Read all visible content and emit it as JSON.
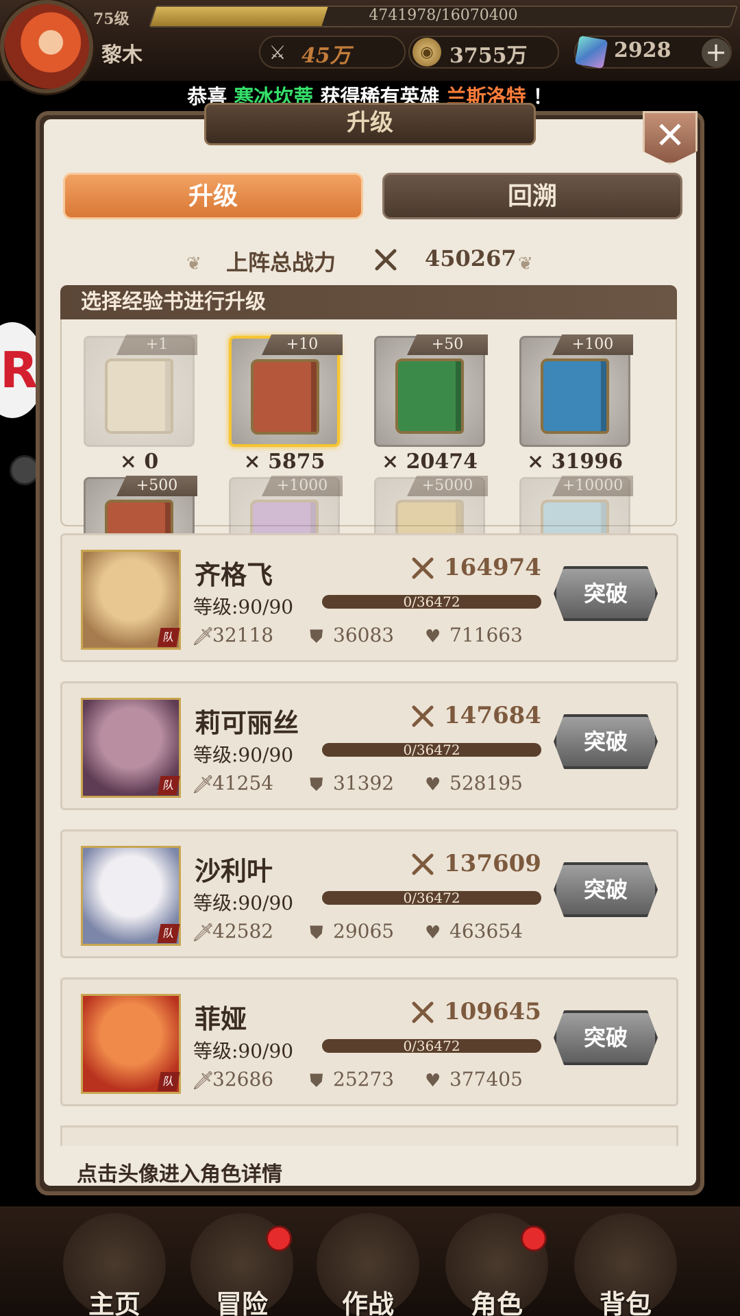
{
  "player": {
    "level": "75级",
    "name": "黎木",
    "xp_text": "4741978/16070400",
    "xp_fraction": 0.295,
    "power": "45万",
    "gold": "3755万",
    "gems": "2928",
    "add_label": "+"
  },
  "announcement": {
    "prefix": "恭喜",
    "player": "寒冰坎蒂",
    "middle": "获得稀有英雄",
    "hero": "兰斯洛特",
    "suffix": "！"
  },
  "panel": {
    "title": "升级",
    "close_label": "✕",
    "tabs": [
      {
        "label": "升级",
        "active": true
      },
      {
        "label": "回溯",
        "active": false
      }
    ],
    "team_power_label": "上阵总战力",
    "team_power_value": "450267",
    "books_header": "选择经验书进行升级",
    "books": [
      {
        "badge": "+1",
        "count": "× 0",
        "color": "#d7c59a",
        "dim": true,
        "selected": false
      },
      {
        "badge": "+10",
        "count": "× 5875",
        "color": "#b4573a",
        "dim": false,
        "selected": true
      },
      {
        "badge": "+50",
        "count": "× 20474",
        "color": "#3c8a4a",
        "dim": false,
        "selected": false
      },
      {
        "badge": "+100",
        "count": "× 31996",
        "color": "#3d86b8",
        "dim": false,
        "selected": false
      },
      {
        "badge": "+500",
        "count": "",
        "color": "#b4573a",
        "dim": false,
        "selected": false
      },
      {
        "badge": "+1000",
        "count": "",
        "color": "#9b6ac2",
        "dim": true,
        "selected": false
      },
      {
        "badge": "+5000",
        "count": "",
        "color": "#c9a44a",
        "dim": true,
        "selected": false
      },
      {
        "badge": "+10000",
        "count": "",
        "color": "#6bb7d8",
        "dim": true,
        "selected": false
      }
    ],
    "heroes": [
      {
        "name": "齐格飞",
        "power": "164974",
        "level": "等级:90/90",
        "exp": "0/36472",
        "atk": "32118",
        "def": "36083",
        "hp": "711663",
        "break_label": "突破",
        "tag": "队",
        "colors": [
          "#e8c890",
          "#a67c4e"
        ]
      },
      {
        "name": "莉可丽丝",
        "power": "147684",
        "level": "等级:90/90",
        "exp": "0/36472",
        "atk": "41254",
        "def": "31392",
        "hp": "528195",
        "break_label": "突破",
        "tag": "队",
        "colors": [
          "#b88ea0",
          "#5e3c54"
        ]
      },
      {
        "name": "沙利叶",
        "power": "137609",
        "level": "等级:90/90",
        "exp": "0/36472",
        "atk": "42582",
        "def": "29065",
        "hp": "463654",
        "break_label": "突破",
        "tag": "队",
        "colors": [
          "#f0eef2",
          "#7c86a8"
        ]
      },
      {
        "name": "菲娅",
        "power": "109645",
        "level": "等级:90/90",
        "exp": "0/36472",
        "atk": "32686",
        "def": "25273",
        "hp": "377405",
        "break_label": "突破",
        "tag": "队",
        "colors": [
          "#f08a4a",
          "#b8321e"
        ]
      }
    ],
    "footnote": "点击头像进入角色详情"
  },
  "nav": [
    {
      "label": "主页",
      "badge": false
    },
    {
      "label": "冒险",
      "badge": true
    },
    {
      "label": "作战",
      "badge": false
    },
    {
      "label": "角色",
      "badge": true
    },
    {
      "label": "背包",
      "badge": false
    }
  ],
  "side": {
    "r_label": "R"
  }
}
